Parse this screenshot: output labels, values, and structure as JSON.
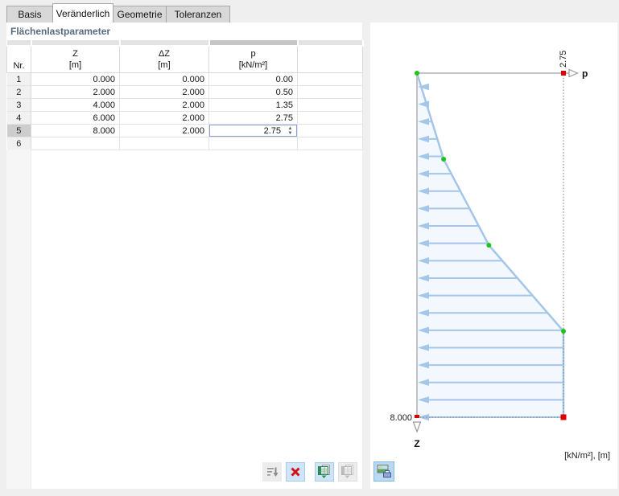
{
  "tabs": [
    {
      "label": "Basis",
      "active": false
    },
    {
      "label": "Veränderlich",
      "active": true
    },
    {
      "label": "Geometrie",
      "active": false
    },
    {
      "label": "Toleranzen",
      "active": false
    }
  ],
  "section_title": "Flächenlastparameter",
  "table": {
    "corner_label": "Nr.",
    "columns": [
      {
        "name": "Z",
        "unit": "[m]"
      },
      {
        "name": "ΔZ",
        "unit": "[m]"
      },
      {
        "name": "p",
        "unit": "[kN/m²]"
      }
    ],
    "rows": [
      {
        "nr": "1",
        "cells": [
          "0.000",
          "0.000",
          "0.00"
        ]
      },
      {
        "nr": "2",
        "cells": [
          "2.000",
          "2.000",
          "0.50"
        ]
      },
      {
        "nr": "3",
        "cells": [
          "4.000",
          "2.000",
          "1.35"
        ]
      },
      {
        "nr": "4",
        "cells": [
          "6.000",
          "2.000",
          "2.75"
        ]
      },
      {
        "nr": "5",
        "cells": [
          "8.000",
          "2.000",
          "2.75"
        ],
        "selected": true,
        "selected_col": 2
      },
      {
        "nr": "6",
        "cells": [
          "",
          "",
          ""
        ]
      }
    ]
  },
  "toolbar": {
    "buttons": [
      {
        "icon": "sort-rows-icon",
        "enabled": true,
        "highlighted": false
      },
      {
        "icon": "delete-rows-icon",
        "enabled": true,
        "highlighted": true
      },
      {
        "icon": "excel-import-icon",
        "enabled": true,
        "highlighted": true
      },
      {
        "icon": "excel-export-icon",
        "enabled": false,
        "highlighted": false
      }
    ]
  },
  "diagram_toolbar": {
    "buttons": [
      {
        "icon": "print-graphic-icon",
        "enabled": true,
        "highlighted": true
      }
    ]
  },
  "chart_data": {
    "type": "area",
    "description": "Veränderliche Flächenlast p über Tiefe Z",
    "points": [
      {
        "z": 0.0,
        "p": 0.0
      },
      {
        "z": 2.0,
        "p": 0.5
      },
      {
        "z": 4.0,
        "p": 1.35
      },
      {
        "z": 6.0,
        "p": 2.75
      },
      {
        "z": 8.0,
        "p": 2.75
      }
    ],
    "z_range": [
      0,
      8
    ],
    "p_range": [
      0,
      2.75
    ],
    "z_axis_label": "Z",
    "p_axis_label": "p",
    "max_p_label": "2.75",
    "max_z_label": "8.000",
    "units_label": "[kN/m²], [m]",
    "legend": "none",
    "grid": false,
    "colors": {
      "load": "#a4c6e9",
      "fill": "#f2f8fd",
      "node": "#1ec41e",
      "endpoint": "#dd0000",
      "axis": "#c2c2c2",
      "dotted": "#8c8c8c"
    }
  }
}
